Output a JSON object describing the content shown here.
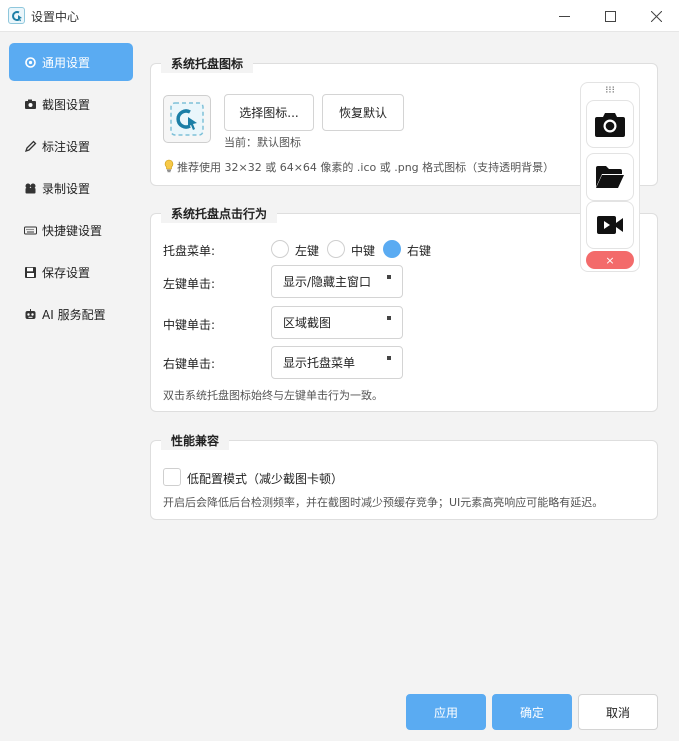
{
  "window": {
    "title": "设置中心",
    "minimize": "—",
    "maximize": "☐",
    "close": "✕"
  },
  "sidebar": {
    "items": [
      {
        "label": "通用设置",
        "icon": "gear-icon",
        "active": true
      },
      {
        "label": "截图设置",
        "icon": "screenshot-icon",
        "active": false
      },
      {
        "label": "标注设置",
        "icon": "pencil-icon",
        "active": false
      },
      {
        "label": "录制设置",
        "icon": "record-icon",
        "active": false
      },
      {
        "label": "快捷键设置",
        "icon": "keyboard-icon",
        "active": false
      },
      {
        "label": "保存设置",
        "icon": "floppy-icon",
        "active": false
      },
      {
        "label": "AI 服务配置",
        "icon": "robot-icon",
        "active": false
      }
    ]
  },
  "tray_icon": {
    "title": "系统托盘图标",
    "choose_button": "选择图标...",
    "reset_button": "恢复默认",
    "current_text": "当前：默认图标",
    "hint": "推荐使用 32×32 或 64×64 像素的 .ico 或 .png 格式图标（支持透明背景）"
  },
  "tray_click": {
    "title": "系统托盘点击行为",
    "menu_label": "托盘菜单:",
    "radios": [
      {
        "label": "左键",
        "checked": false
      },
      {
        "label": "中键",
        "checked": false
      },
      {
        "label": "右键",
        "checked": true
      }
    ],
    "left_label": "左键单击:",
    "left_value": "显示/隐藏主窗口",
    "middle_label": "中键单击:",
    "middle_value": "区域截图",
    "right_label": "右键单击:",
    "right_value": "显示托盘菜单",
    "note": "双击系统托盘图标始终与左键单击行为一致。"
  },
  "performance": {
    "title": "性能兼容",
    "checkbox_label": "低配置模式（减少截图卡顿）",
    "checked": false,
    "note": "开启后会降低后台检测频率，并在截图时减少预缓存竞争；UI元素高亮响应可能略有延迟。"
  },
  "float_toolbar": {
    "handle": "⁝⁝⁝",
    "tools": [
      "camera-icon",
      "folder-icon",
      "video-icon"
    ],
    "close": "×"
  },
  "footer": {
    "apply": "应用",
    "ok": "确定",
    "cancel": "取消"
  },
  "colors": {
    "accent": "#5aabf2",
    "danger": "#f36b6b"
  }
}
